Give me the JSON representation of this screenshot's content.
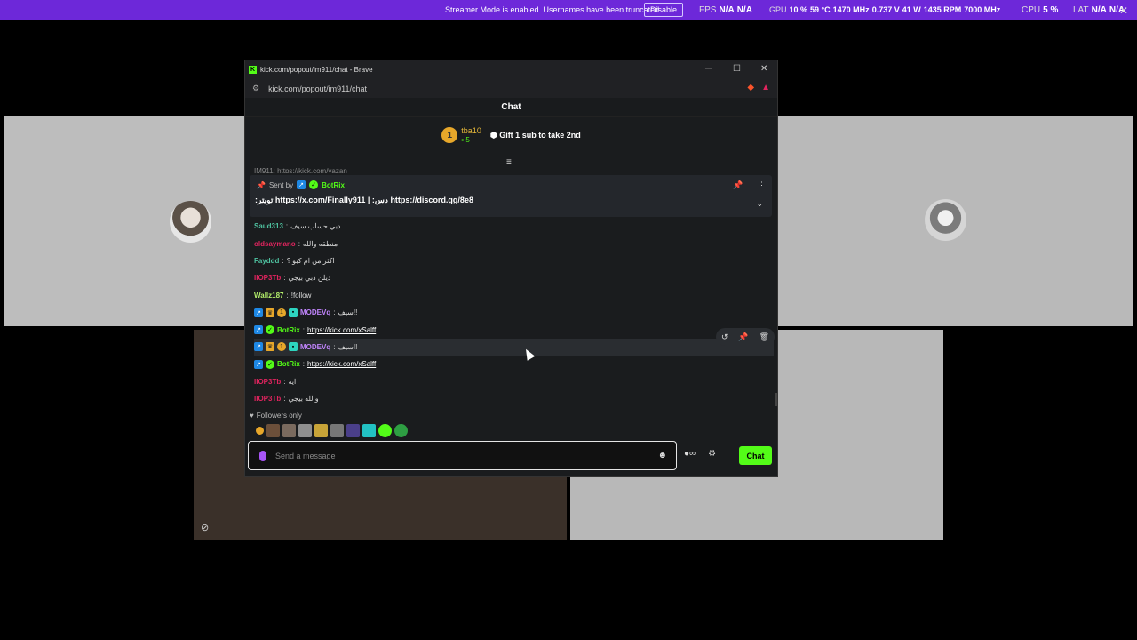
{
  "banner": {
    "message": "Streamer Mode is enabled. Usernames have been truncated.",
    "disable_label": "Disable",
    "fps_label": "FPS",
    "fps_value": "N/A",
    "fps_value2": "N/A",
    "gpu_label": "GPU",
    "gpu_load": "10 %",
    "gpu_temp": "59 °C",
    "gpu_clock": "1470 MHz",
    "gpu_volt": "0.737 V",
    "gpu_power": "41 W",
    "gpu_fan": "1435 RPM",
    "gpu_mem": "7000 MHz",
    "cpu_label": "CPU",
    "cpu_value": "5 %",
    "lat_label": "LAT",
    "lat_value": "N/A",
    "lat_value2": "N/A"
  },
  "window": {
    "title": "kick.com/popout/im911/chat - Brave",
    "url": "kick.com/popout/im911/chat"
  },
  "chat": {
    "header": "Chat",
    "leader": {
      "rank": "1",
      "name": "tba10",
      "count": "5"
    },
    "gift_text": "Gift 1 sub to take 2nd",
    "cut_line": "IM911: https://kick.com/yazan",
    "pinned": {
      "sent_by": "Sent by",
      "bot": "BotRix",
      "prefix": ":تويتر",
      "link1": "https://x.com/Finally911",
      "sep": "| :دس",
      "link2": "https://discord.gg/8e8"
    },
    "messages": [
      {
        "user": "Saud313",
        "color": "#4fc3a1",
        "text": "دبي حساب سيف"
      },
      {
        "user": "oldsaymano",
        "color": "#e0245e",
        "text": "منطقه والله"
      },
      {
        "user": "Fayddd",
        "color": "#4fc3a1",
        "text": "اكثر من ام كبو ؟"
      },
      {
        "user": "IIOP3Tb",
        "color": "#e0245e",
        "text": "ديلن دبي بيجي"
      },
      {
        "user": "Wallz187",
        "color": "#b4f06b",
        "text": "!follow"
      },
      {
        "user": "MODEVq",
        "color": "#c084fc",
        "text": "سيف!!"
      },
      {
        "user": "BotRix",
        "color": "#53fc18",
        "link": "https://kick.com/xSalff"
      },
      {
        "user": "MODEVq",
        "color": "#c084fc",
        "text": "سيف!!"
      },
      {
        "user": "BotRix",
        "color": "#53fc18",
        "link": "https://kick.com/xSalff"
      },
      {
        "user": "IIOP3Tb",
        "color": "#e0245e",
        "text": "ايه"
      },
      {
        "user": "IIOP3Tb",
        "color": "#e0245e",
        "text": "والله بيجي"
      }
    ],
    "followers_only": "Followers only",
    "input_placeholder": "Send a message",
    "send_label": "Chat"
  },
  "colors": {
    "kick_green": "#53fc18",
    "banner": "#6d28d9"
  }
}
